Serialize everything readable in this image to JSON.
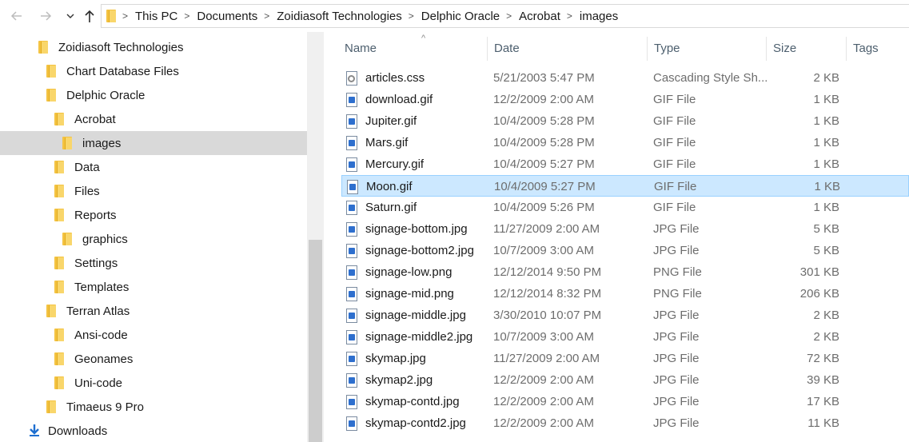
{
  "nav": {
    "back_icon": "arrow-left-icon",
    "forward_icon": "arrow-right-icon",
    "recent_icon": "chevron-down-icon",
    "up_icon": "arrow-up-icon"
  },
  "address": {
    "crumbs": [
      "This PC",
      "Documents",
      "Zoidiasoft Technologies",
      "Delphic Oracle",
      "Acrobat",
      "images"
    ]
  },
  "sidebar": {
    "items": [
      {
        "label": "Zoidiasoft Technologies",
        "icon": "folder-icon"
      },
      {
        "label": "Chart Database Files",
        "icon": "folder-icon"
      },
      {
        "label": "Delphic Oracle",
        "icon": "folder-icon"
      },
      {
        "label": "Acrobat",
        "icon": "folder-icon"
      },
      {
        "label": "images",
        "icon": "folder-icon",
        "selected": true
      },
      {
        "label": "Data",
        "icon": "folder-icon"
      },
      {
        "label": "Files",
        "icon": "folder-icon"
      },
      {
        "label": "Reports",
        "icon": "folder-icon"
      },
      {
        "label": "graphics",
        "icon": "folder-icon"
      },
      {
        "label": "Settings",
        "icon": "folder-icon"
      },
      {
        "label": "Templates",
        "icon": "folder-icon"
      },
      {
        "label": "Terran Atlas",
        "icon": "folder-icon"
      },
      {
        "label": "Ansi-code",
        "icon": "folder-icon"
      },
      {
        "label": "Geonames",
        "icon": "folder-icon"
      },
      {
        "label": "Uni-code",
        "icon": "folder-icon"
      },
      {
        "label": "Timaeus 9 Pro",
        "icon": "folder-icon"
      },
      {
        "label": "Downloads",
        "icon": "download-arrow-icon"
      }
    ]
  },
  "columns": {
    "name": "Name",
    "date": "Date",
    "type": "Type",
    "size": "Size",
    "tags": "Tags"
  },
  "files": [
    {
      "name": "articles.css",
      "date": "5/21/2003 5:47 PM",
      "type": "Cascading Style Sh...",
      "size": "2 KB",
      "icon": "css-file-icon"
    },
    {
      "name": "download.gif",
      "date": "12/2/2009 2:00 AM",
      "type": "GIF File",
      "size": "1 KB",
      "icon": "image-file-icon"
    },
    {
      "name": "Jupiter.gif",
      "date": "10/4/2009 5:28 PM",
      "type": "GIF File",
      "size": "1 KB",
      "icon": "image-file-icon"
    },
    {
      "name": "Mars.gif",
      "date": "10/4/2009 5:28 PM",
      "type": "GIF File",
      "size": "1 KB",
      "icon": "image-file-icon"
    },
    {
      "name": "Mercury.gif",
      "date": "10/4/2009 5:27 PM",
      "type": "GIF File",
      "size": "1 KB",
      "icon": "image-file-icon"
    },
    {
      "name": "Moon.gif",
      "date": "10/4/2009 5:27 PM",
      "type": "GIF File",
      "size": "1 KB",
      "icon": "image-file-icon",
      "selected": true
    },
    {
      "name": "Saturn.gif",
      "date": "10/4/2009 5:26 PM",
      "type": "GIF File",
      "size": "1 KB",
      "icon": "image-file-icon"
    },
    {
      "name": "signage-bottom.jpg",
      "date": "11/27/2009 2:00 AM",
      "type": "JPG File",
      "size": "5 KB",
      "icon": "image-file-icon"
    },
    {
      "name": "signage-bottom2.jpg",
      "date": "10/7/2009 3:00 AM",
      "type": "JPG File",
      "size": "5 KB",
      "icon": "image-file-icon"
    },
    {
      "name": "signage-low.png",
      "date": "12/12/2014 9:50 PM",
      "type": "PNG File",
      "size": "301 KB",
      "icon": "image-file-icon"
    },
    {
      "name": "signage-mid.png",
      "date": "12/12/2014 8:32 PM",
      "type": "PNG File",
      "size": "206 KB",
      "icon": "image-file-icon"
    },
    {
      "name": "signage-middle.jpg",
      "date": "3/30/2010 10:07 PM",
      "type": "JPG File",
      "size": "2 KB",
      "icon": "image-file-icon"
    },
    {
      "name": "signage-middle2.jpg",
      "date": "10/7/2009 3:00 AM",
      "type": "JPG File",
      "size": "2 KB",
      "icon": "image-file-icon"
    },
    {
      "name": "skymap.jpg",
      "date": "11/27/2009 2:00 AM",
      "type": "JPG File",
      "size": "72 KB",
      "icon": "image-file-icon"
    },
    {
      "name": "skymap2.jpg",
      "date": "12/2/2009 2:00 AM",
      "type": "JPG File",
      "size": "39 KB",
      "icon": "image-file-icon"
    },
    {
      "name": "skymap-contd.jpg",
      "date": "12/2/2009 2:00 AM",
      "type": "JPG File",
      "size": "17 KB",
      "icon": "image-file-icon"
    },
    {
      "name": "skymap-contd2.jpg",
      "date": "12/2/2009 2:00 AM",
      "type": "JPG File",
      "size": "11 KB",
      "icon": "image-file-icon"
    }
  ],
  "colors": {
    "selected_row_bg": "#cce8ff",
    "selected_row_border": "#99d1ff",
    "sidebar_selected_bg": "#d9d9d9",
    "folder_yellow": "#f4c342"
  }
}
